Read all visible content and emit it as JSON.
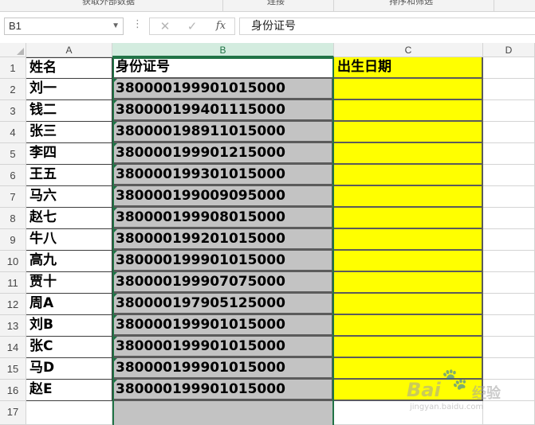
{
  "ribbon": {
    "groups": [
      "获取外部数据",
      "连接",
      "排序和筛选"
    ]
  },
  "formula_bar": {
    "name_box": "B1",
    "more_icon": "⋮",
    "cancel_icon": "✕",
    "enter_icon": "✓",
    "fx_label": "fx",
    "content": "身份证号"
  },
  "columns": [
    "A",
    "B",
    "C",
    "D"
  ],
  "selected_column": "B",
  "headers": {
    "name": "姓名",
    "id": "身份证号",
    "birth": "出生日期"
  },
  "rows": [
    {
      "row": "2",
      "name": "刘一",
      "id": "380000199901015000"
    },
    {
      "row": "3",
      "name": "钱二",
      "id": "380000199401115000"
    },
    {
      "row": "4",
      "name": "张三",
      "id": "380000198911015000"
    },
    {
      "row": "5",
      "name": "李四",
      "id": "380000199901215000"
    },
    {
      "row": "6",
      "name": "王五",
      "id": "380000199301015000"
    },
    {
      "row": "7",
      "name": "马六",
      "id": "380000199009095000"
    },
    {
      "row": "8",
      "name": "赵七",
      "id": "380000199908015000"
    },
    {
      "row": "9",
      "name": "牛八",
      "id": "380000199201015000"
    },
    {
      "row": "10",
      "name": "高九",
      "id": "380000199901015000"
    },
    {
      "row": "11",
      "name": "贾十",
      "id": "380000199907075000"
    },
    {
      "row": "12",
      "name": "周A",
      "id": "380000197905125000"
    },
    {
      "row": "13",
      "name": "刘B",
      "id": "380000199901015000"
    },
    {
      "row": "14",
      "name": "张C",
      "id": "380000199901015000"
    },
    {
      "row": "15",
      "name": "马D",
      "id": "380000199901015000"
    },
    {
      "row": "16",
      "name": "赵E",
      "id": "380000199901015000"
    }
  ],
  "row_numbers": [
    "1",
    "2",
    "3",
    "4",
    "5",
    "6",
    "7",
    "8",
    "9",
    "10",
    "11",
    "12",
    "13",
    "14",
    "15",
    "16",
    "17"
  ],
  "watermark": {
    "brand": "Bai",
    "paw": "🐾",
    "suffix": "经验",
    "sub": "jingyan.baidu.com"
  },
  "colors": {
    "highlight": "#ffff00",
    "id_fill": "#c3c3c3",
    "selection": "#217346"
  }
}
